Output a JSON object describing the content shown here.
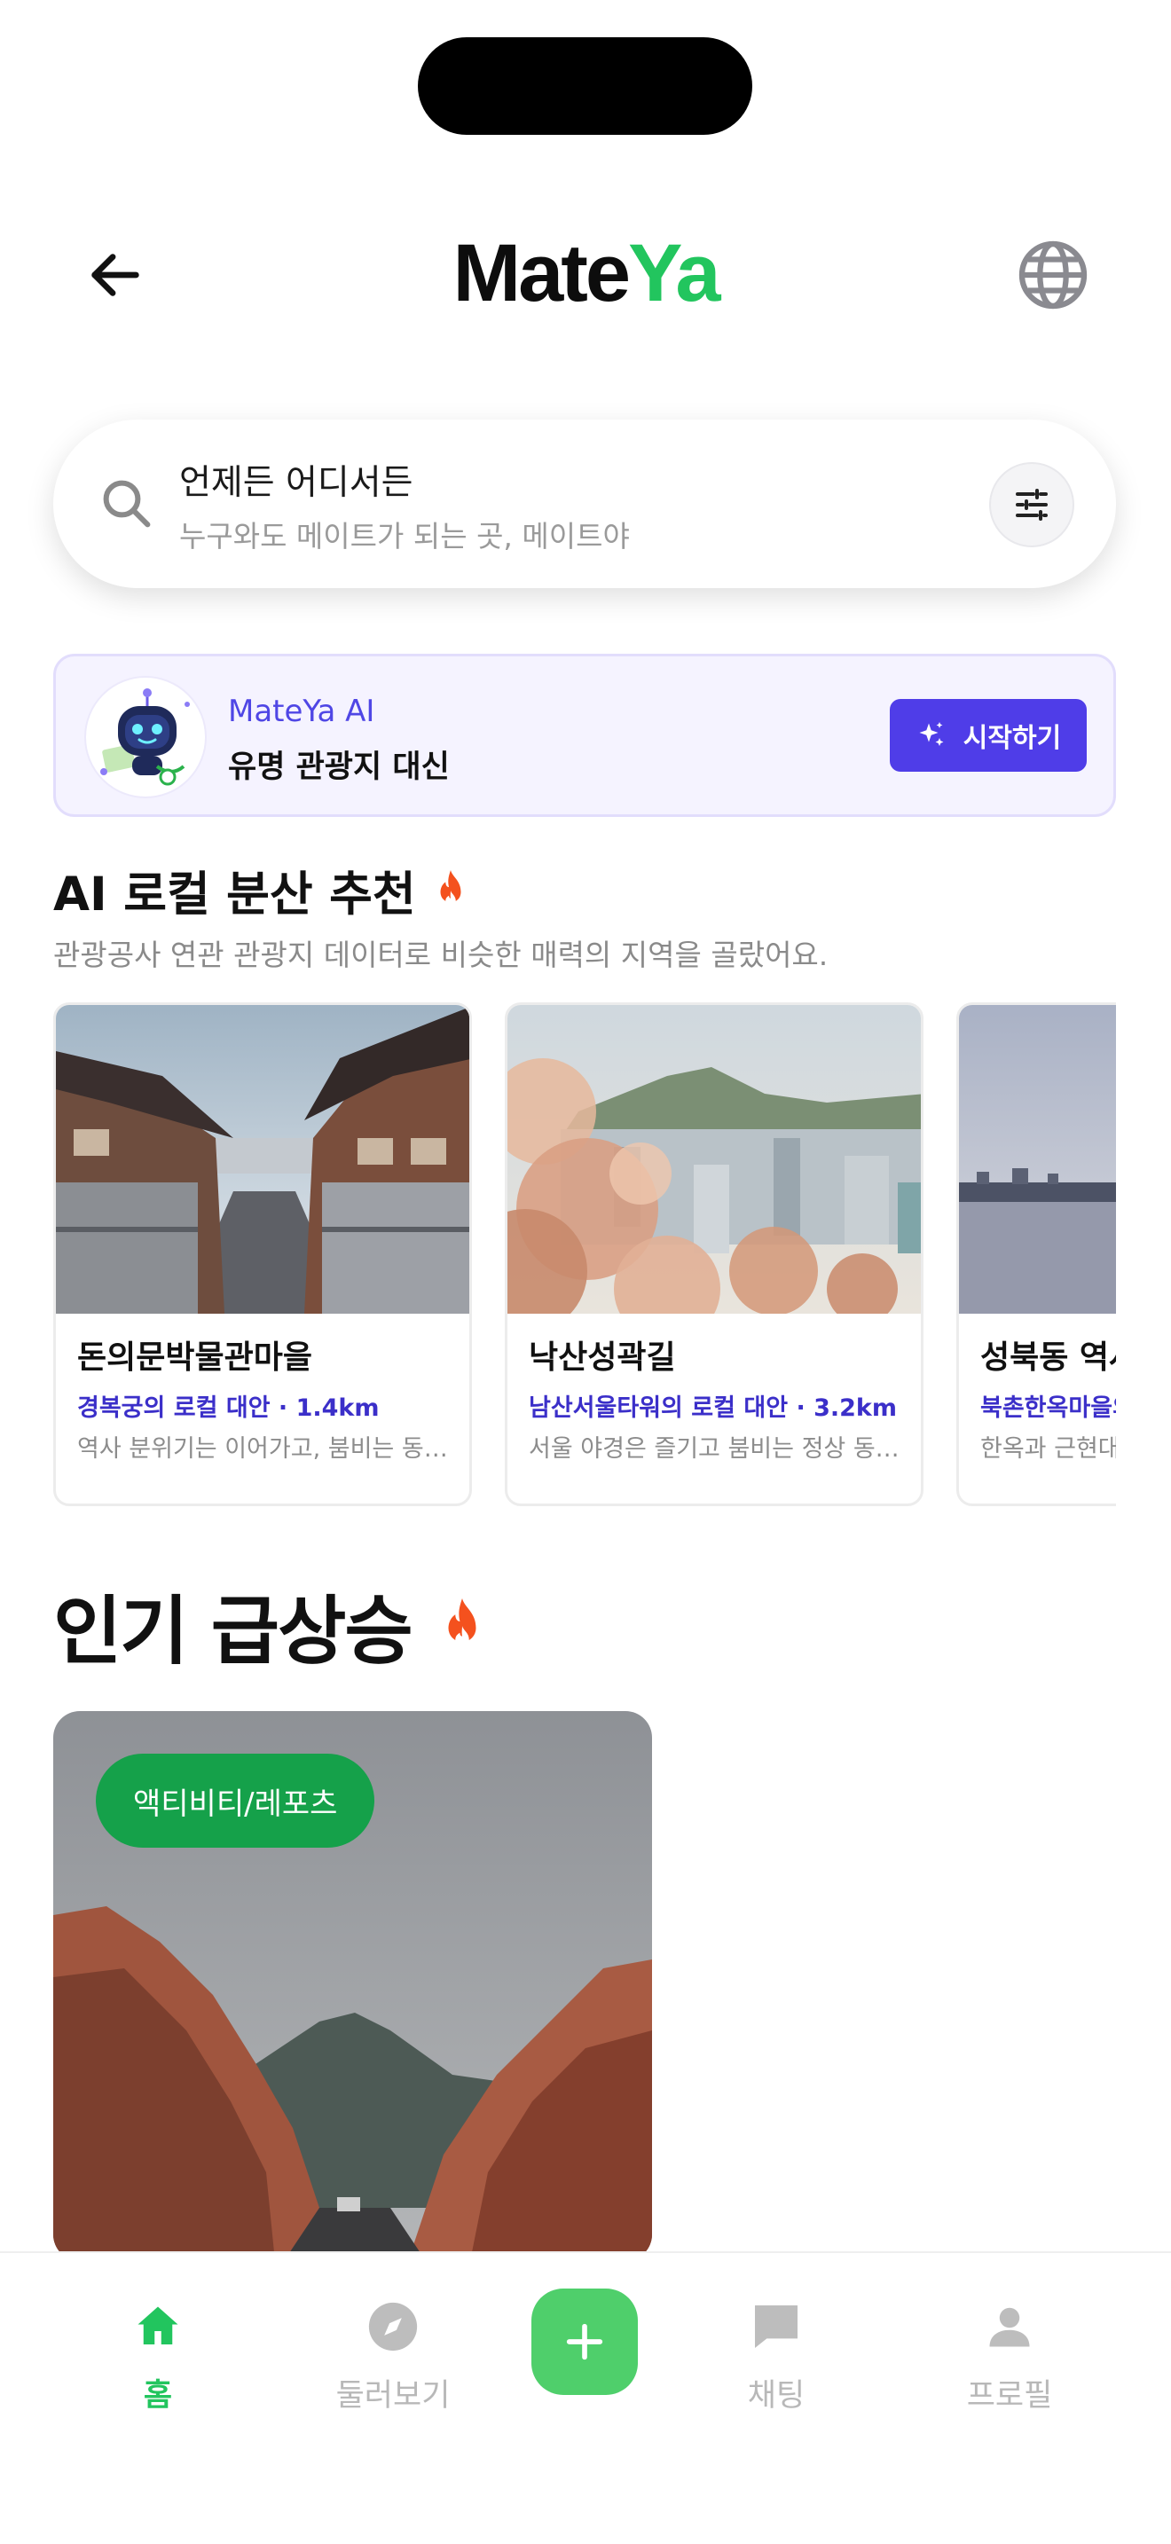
{
  "app": {
    "logo_part1": "Mate",
    "logo_part2": "Ya"
  },
  "header": {
    "back_icon": "arrow-left-icon",
    "globe_icon": "globe-icon"
  },
  "search": {
    "title": "언제든 어디서든",
    "subtitle": "누구와도 메이트가 되는 곳, 메이트야",
    "icon": "search-icon",
    "filter_icon": "sliders-icon"
  },
  "ai_banner": {
    "title": "MateYa AI",
    "description": "유명 관광지 대신",
    "button_label": "시작하기",
    "button_icon": "sparkles-icon"
  },
  "ai_section": {
    "title": "AI 로컬 분산 추천",
    "subtitle": "관광공사 연관 관광지 데이터로 비슷한 매력의 지역을 골랐어요.",
    "cards": [
      {
        "title": "돈의문박물관마을",
        "subtitle": "경복궁의 로컬 대안 · 1.4km",
        "description": "역사 분위기는 이어가고, 붐비는 동선…"
      },
      {
        "title": "낙산성곽길",
        "subtitle": "남산서울타워의 로컬 대안 · 3.2km",
        "description": "서울 야경은 즐기고 붐비는 정상 동선…"
      },
      {
        "title": "성북동 역사",
        "subtitle": "북촌한옥마을의",
        "description": "한옥과 근현대"
      }
    ]
  },
  "popular_section": {
    "title": "인기 급상승",
    "card": {
      "tag": "액티비티/레포츠"
    }
  },
  "tabbar": {
    "items": [
      {
        "label": "홈",
        "icon": "home-icon",
        "active": true
      },
      {
        "label": "둘러보기",
        "icon": "compass-icon",
        "active": false
      },
      {
        "label": "채팅",
        "icon": "chat-icon",
        "active": false
      },
      {
        "label": "프로필",
        "icon": "profile-icon",
        "active": false
      }
    ],
    "fab_icon": "plus-icon"
  },
  "colors": {
    "brand_green": "#22c55e",
    "ai_purple": "#4f46e5",
    "button_purple": "#4f3de8",
    "tag_green": "#15a14a"
  }
}
